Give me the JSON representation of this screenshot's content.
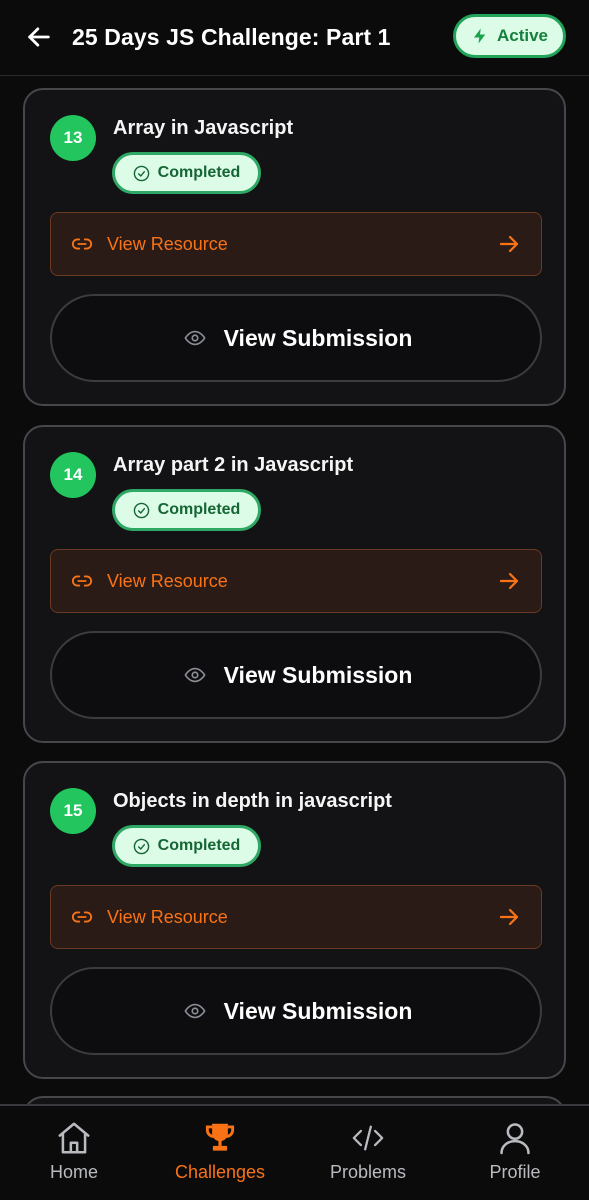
{
  "header": {
    "title": "25 Days JS Challenge: Part 1",
    "status": "Active",
    "back_icon": "arrow-left-icon",
    "status_icon": "lightning-icon"
  },
  "tasks": [
    {
      "number": "13",
      "title": "Array in Javascript",
      "status": "Completed",
      "resource_label": "View Resource",
      "submission_label": "View Submission"
    },
    {
      "number": "14",
      "title": "Array part 2 in Javascript",
      "status": "Completed",
      "resource_label": "View Resource",
      "submission_label": "View Submission"
    },
    {
      "number": "15",
      "title": "Objects in depth in javascript",
      "status": "Completed",
      "resource_label": "View Resource",
      "submission_label": "View Submission"
    }
  ],
  "nav": {
    "active": "Challenges",
    "items": [
      {
        "label": "Home",
        "icon": "home-icon"
      },
      {
        "label": "Challenges",
        "icon": "trophy-icon"
      },
      {
        "label": "Problems",
        "icon": "code-icon"
      },
      {
        "label": "Profile",
        "icon": "user-icon"
      }
    ]
  },
  "colors": {
    "accent": "#f97316",
    "success": "#22c55e",
    "badge_bg": "#dcfce7",
    "background": "#0b0b0c",
    "card_bg": "#131315"
  }
}
